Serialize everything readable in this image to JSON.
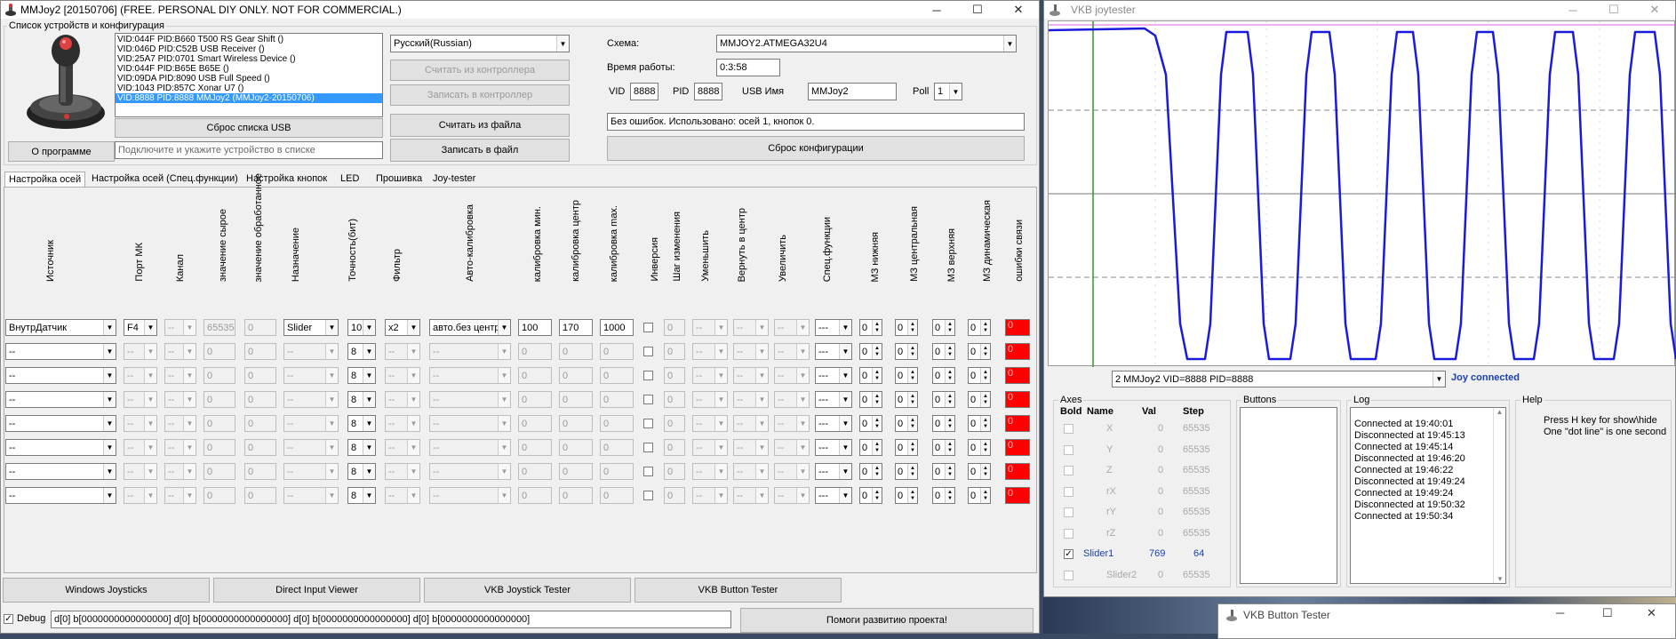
{
  "main_window": {
    "title": "MMJoy2 [20150706] (FREE. PERSONAL DIY ONLY. NOT FOR COMMERCIAL.)",
    "group_devices_label": "Список устройств и конфигурация",
    "devices": [
      "VID:044F PID:B660 T500 RS Gear Shift ()",
      "VID:046D PID:C52B USB Receiver ()",
      "VID:25A7 PID:0701 Smart Wireless Device ()",
      "VID:044F PID:B65E B65E ()",
      "VID:09DA PID:8090 USB Full Speed ()",
      "VID:1043 PID:857C Xonar U7 ()",
      "VID:8888 PID:8888 MMJoy2 (MMJoy2-20150706)"
    ],
    "about_button": "О программе",
    "reset_list_button": "Сброс списка USB",
    "connect_hint": "Подключите и укажите устройство в списке",
    "language": "Русский(Russian)",
    "read_from_controller": "Считать из контроллера",
    "write_to_controller": "Записать в контроллер",
    "read_from_file": "Считать из файла",
    "write_to_file": "Записать в файл",
    "scheme_label": "Схема:",
    "scheme_value": "MMJOY2.ATMEGA32U4",
    "uptime_label": "Время работы:",
    "uptime_value": "0:3:58",
    "vid_label": "VID",
    "vid_value": "8888",
    "pid_label": "PID",
    "pid_value": "8888",
    "usbname_label": "USB Имя",
    "usbname_value": "MMJoy2",
    "poll_label": "Poll",
    "poll_value": "1",
    "status_text": "Без ошибок. Использовано: осей  1, кнопок  0.",
    "reset_config_button": "Сброс конфигурации",
    "tabs": [
      "Настройка осей",
      "Настройка осей (Спец.функции)",
      "Настройка кнопок",
      "LED",
      "Прошивка",
      "Joy-tester"
    ],
    "columns": [
      "Источник",
      "Порт МК",
      "Канал",
      "значение сырое",
      "значение обработанное",
      "Назначение",
      "Точность(бит)",
      "Фильтр",
      "Авто-калибровка",
      "калибровка мин.",
      "калибровка центр",
      "калибровка max.",
      "Инверсия",
      "Шаг изменения",
      "Уменьшить",
      "Вернуть в центр",
      "Увеличить",
      "Спец.функции",
      "МЗ нижняя",
      "МЗ центральная",
      "МЗ верхняя",
      "МЗ динамическая",
      "ошибки связи"
    ],
    "rows": [
      {
        "source": "ВнутрДатчик",
        "port": "F4",
        "channel": "--",
        "raw": "65535",
        "proc": "0",
        "assign": "Slider",
        "bits": "10",
        "filter": "x2",
        "autocal": "авто.без центр",
        "cmin": "100",
        "ccen": "170",
        "cmax": "1000",
        "step": "0",
        "dec": "--",
        "center": "--",
        "inc": "--",
        "spec": "---",
        "dz_low": "0",
        "dz_cen": "0",
        "dz_up": "0",
        "dz_dyn": "0",
        "err": "0"
      },
      {
        "source": "--",
        "port": "--",
        "channel": "--",
        "raw": "0",
        "proc": "0",
        "assign": "--",
        "bits": "8",
        "filter": "--",
        "autocal": "--",
        "cmin": "0",
        "ccen": "0",
        "cmax": "0",
        "step": "0",
        "dec": "--",
        "center": "--",
        "inc": "--",
        "spec": "---",
        "dz_low": "0",
        "dz_cen": "0",
        "dz_up": "0",
        "dz_dyn": "0",
        "err": "0"
      },
      {
        "source": "--",
        "port": "--",
        "channel": "--",
        "raw": "0",
        "proc": "0",
        "assign": "--",
        "bits": "8",
        "filter": "--",
        "autocal": "--",
        "cmin": "0",
        "ccen": "0",
        "cmax": "0",
        "step": "0",
        "dec": "--",
        "center": "--",
        "inc": "--",
        "spec": "---",
        "dz_low": "0",
        "dz_cen": "0",
        "dz_up": "0",
        "dz_dyn": "0",
        "err": "0"
      },
      {
        "source": "--",
        "port": "--",
        "channel": "--",
        "raw": "0",
        "proc": "0",
        "assign": "--",
        "bits": "8",
        "filter": "--",
        "autocal": "--",
        "cmin": "0",
        "ccen": "0",
        "cmax": "0",
        "step": "0",
        "dec": "--",
        "center": "--",
        "inc": "--",
        "spec": "---",
        "dz_low": "0",
        "dz_cen": "0",
        "dz_up": "0",
        "dz_dyn": "0",
        "err": "0"
      },
      {
        "source": "--",
        "port": "--",
        "channel": "--",
        "raw": "0",
        "proc": "0",
        "assign": "--",
        "bits": "8",
        "filter": "--",
        "autocal": "--",
        "cmin": "0",
        "ccen": "0",
        "cmax": "0",
        "step": "0",
        "dec": "--",
        "center": "--",
        "inc": "--",
        "spec": "---",
        "dz_low": "0",
        "dz_cen": "0",
        "dz_up": "0",
        "dz_dyn": "0",
        "err": "0"
      },
      {
        "source": "--",
        "port": "--",
        "channel": "--",
        "raw": "0",
        "proc": "0",
        "assign": "--",
        "bits": "8",
        "filter": "--",
        "autocal": "--",
        "cmin": "0",
        "ccen": "0",
        "cmax": "0",
        "step": "0",
        "dec": "--",
        "center": "--",
        "inc": "--",
        "spec": "---",
        "dz_low": "0",
        "dz_cen": "0",
        "dz_up": "0",
        "dz_dyn": "0",
        "err": "0"
      },
      {
        "source": "--",
        "port": "--",
        "channel": "--",
        "raw": "0",
        "proc": "0",
        "assign": "--",
        "bits": "8",
        "filter": "--",
        "autocal": "--",
        "cmin": "0",
        "ccen": "0",
        "cmax": "0",
        "step": "0",
        "dec": "--",
        "center": "--",
        "inc": "--",
        "spec": "---",
        "dz_low": "0",
        "dz_cen": "0",
        "dz_up": "0",
        "dz_dyn": "0",
        "err": "0"
      },
      {
        "source": "--",
        "port": "--",
        "channel": "--",
        "raw": "0",
        "proc": "0",
        "assign": "--",
        "bits": "8",
        "filter": "--",
        "autocal": "--",
        "cmin": "0",
        "ccen": "0",
        "cmax": "0",
        "step": "0",
        "dec": "--",
        "center": "--",
        "inc": "--",
        "spec": "---",
        "dz_low": "0",
        "dz_cen": "0",
        "dz_up": "0",
        "dz_dyn": "0",
        "err": "0"
      }
    ],
    "bottom_buttons": [
      "Windows Joysticks",
      "Direct Input Viewer",
      "VKB Joystick Tester",
      "VKB Button Tester"
    ],
    "debug_label": "Debug",
    "debug_text": "d[0] b[0000000000000000]   d[0] b[0000000000000000]   d[0] b[0000000000000000]   d[0] b[0000000000000000]",
    "help_button": "Помоги развитию проекта!"
  },
  "joytester": {
    "title": "VKB joytester",
    "device": "2 MMJoy2 VID=8888 PID=8888",
    "status": "Joy connected",
    "axes_group": "Axes",
    "axes_headers": [
      "Bold",
      "Name",
      "Val",
      "Step"
    ],
    "axes": [
      {
        "name": "X",
        "val": "0",
        "step": "65535",
        "checked": false
      },
      {
        "name": "Y",
        "val": "0",
        "step": "65535",
        "checked": false
      },
      {
        "name": "Z",
        "val": "0",
        "step": "65535",
        "checked": false
      },
      {
        "name": "rX",
        "val": "0",
        "step": "65535",
        "checked": false
      },
      {
        "name": "rY",
        "val": "0",
        "step": "65535",
        "checked": false
      },
      {
        "name": "rZ",
        "val": "0",
        "step": "65535",
        "checked": false
      },
      {
        "name": "Slider1",
        "val": "769",
        "step": "64",
        "checked": true
      },
      {
        "name": "Slider2",
        "val": "0",
        "step": "65535",
        "checked": false
      }
    ],
    "buttons_group": "Buttons",
    "log_group": "Log",
    "log": [
      "Connected at 19:40:01",
      "Disconnected at 19:45:13",
      "Connected at 19:45:14",
      "Disconnected at 19:46:20",
      "Connected at 19:46:22",
      "Disconnected at 19:49:24",
      "Connected at 19:49:24",
      "Disconnected at 19:50:32",
      "Connected at 19:50:34"
    ],
    "help_group": "Help",
    "help_lines": [
      "Press H key for show\\hide",
      "One \"dot line\" is one second"
    ]
  },
  "button_tester": {
    "title": "VKB Button Tester"
  },
  "colors": {
    "trace": "#1a1adc",
    "marker": "#2a9a2a",
    "error_cell": "#ff0000",
    "status_blue": "#1a3fb0"
  }
}
